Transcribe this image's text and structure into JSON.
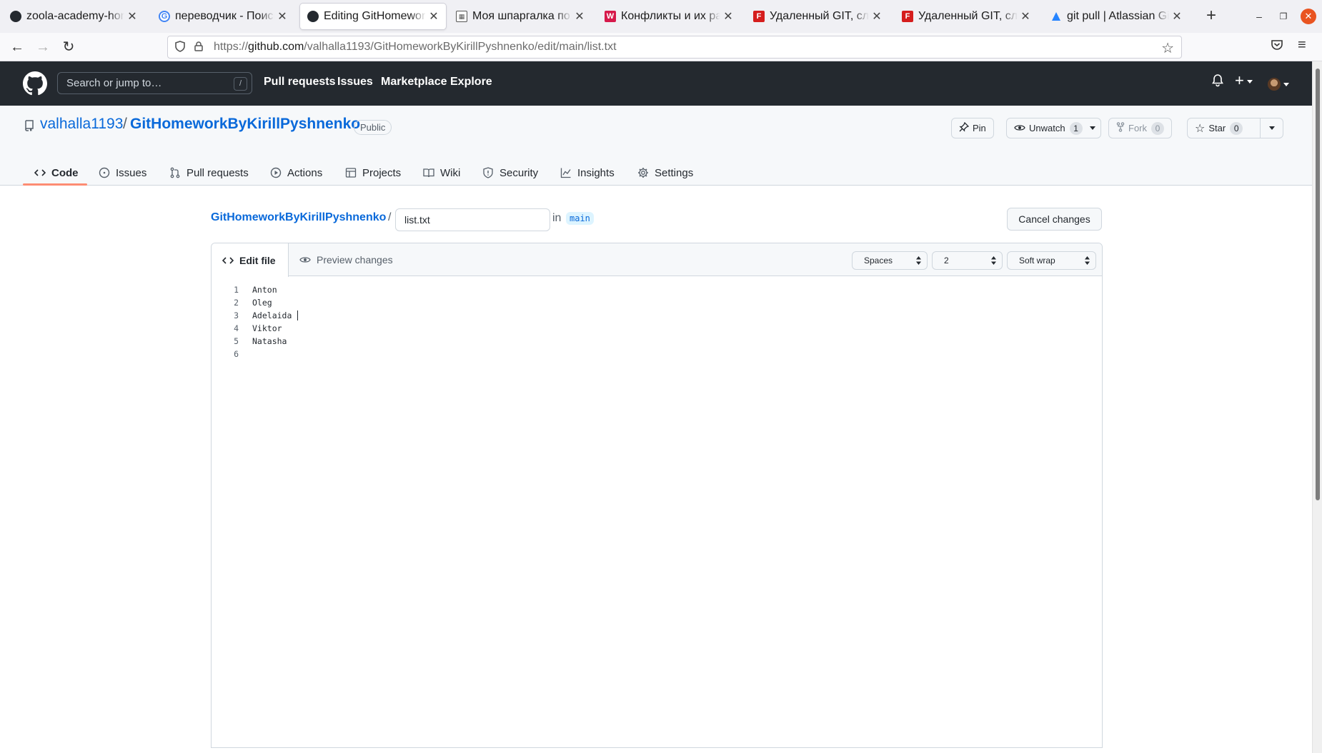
{
  "browser": {
    "tabs": [
      {
        "title": "zoola-academy-homew",
        "favicon": "github-icon",
        "color": "#24292f"
      },
      {
        "title": "переводчик - Поиск в",
        "favicon": "google-icon",
        "color": "#4285f4"
      },
      {
        "title": "Editing GitHomeworkB",
        "favicon": "github-icon",
        "color": "#24292f",
        "active": true
      },
      {
        "title": "Моя шпаргалка по ра",
        "favicon": "table-icon",
        "color": "#555555"
      },
      {
        "title": "Конфликты и их разре",
        "favicon": "w-icon",
        "color": "#d6194b"
      },
      {
        "title": "Удаленный GIT, слиян",
        "favicon": "f-icon",
        "color": "#d51d1d"
      },
      {
        "title": "Удаленный GIT, слиян",
        "favicon": "f-icon",
        "color": "#d51d1d"
      },
      {
        "title": "git pull | Atlassian Git",
        "favicon": "atlassian-icon",
        "color": "#2684ff"
      }
    ],
    "new_tab": "+",
    "url_prefix": "https://",
    "url_host": "github.com",
    "url_path": "/valhalla1193/GitHomeworkByKirillPyshnenko/edit/main/list.txt"
  },
  "gh": {
    "search_placeholder": "Search or jump to…",
    "search_shortcut": "/",
    "nav": [
      "Pull requests",
      "Issues",
      "Marketplace",
      "Explore"
    ],
    "plus": "+"
  },
  "repo": {
    "owner": "valhalla1193",
    "separator": "/",
    "name": "GitHomeworkByKirillPyshnenko",
    "visibility": "Public",
    "pin_label": "Pin",
    "unwatch_label": "Unwatch",
    "unwatch_count": "1",
    "fork_label": "Fork",
    "fork_count": "0",
    "star_label": "Star",
    "star_count": "0",
    "tabs": [
      {
        "label": "Code",
        "icon": "code-icon"
      },
      {
        "label": "Issues",
        "icon": "issue-icon"
      },
      {
        "label": "Pull requests",
        "icon": "pull-request-icon"
      },
      {
        "label": "Actions",
        "icon": "play-icon"
      },
      {
        "label": "Projects",
        "icon": "table-icon"
      },
      {
        "label": "Wiki",
        "icon": "book-icon"
      },
      {
        "label": "Security",
        "icon": "shield-icon"
      },
      {
        "label": "Insights",
        "icon": "graph-icon"
      },
      {
        "label": "Settings",
        "icon": "gear-icon"
      }
    ]
  },
  "editor": {
    "breadcrumb_repo": "GitHomeworkByKirillPyshnenko",
    "breadcrumb_sep": "/",
    "filename": "list.txt",
    "in_label": "in",
    "branch": "main",
    "cancel_label": "Cancel changes",
    "edit_tab_label": "Edit file",
    "preview_tab_label": "Preview changes",
    "indent_mode": "Spaces",
    "indent_size": "2",
    "wrap_mode": "Soft wrap",
    "lines": [
      {
        "no": "1",
        "text": "Anton"
      },
      {
        "no": "2",
        "text": "Oleg"
      },
      {
        "no": "3",
        "text": "Adelaida"
      },
      {
        "no": "4",
        "text": "Viktor"
      },
      {
        "no": "5",
        "text": "Natasha"
      },
      {
        "no": "6",
        "text": ""
      }
    ]
  }
}
